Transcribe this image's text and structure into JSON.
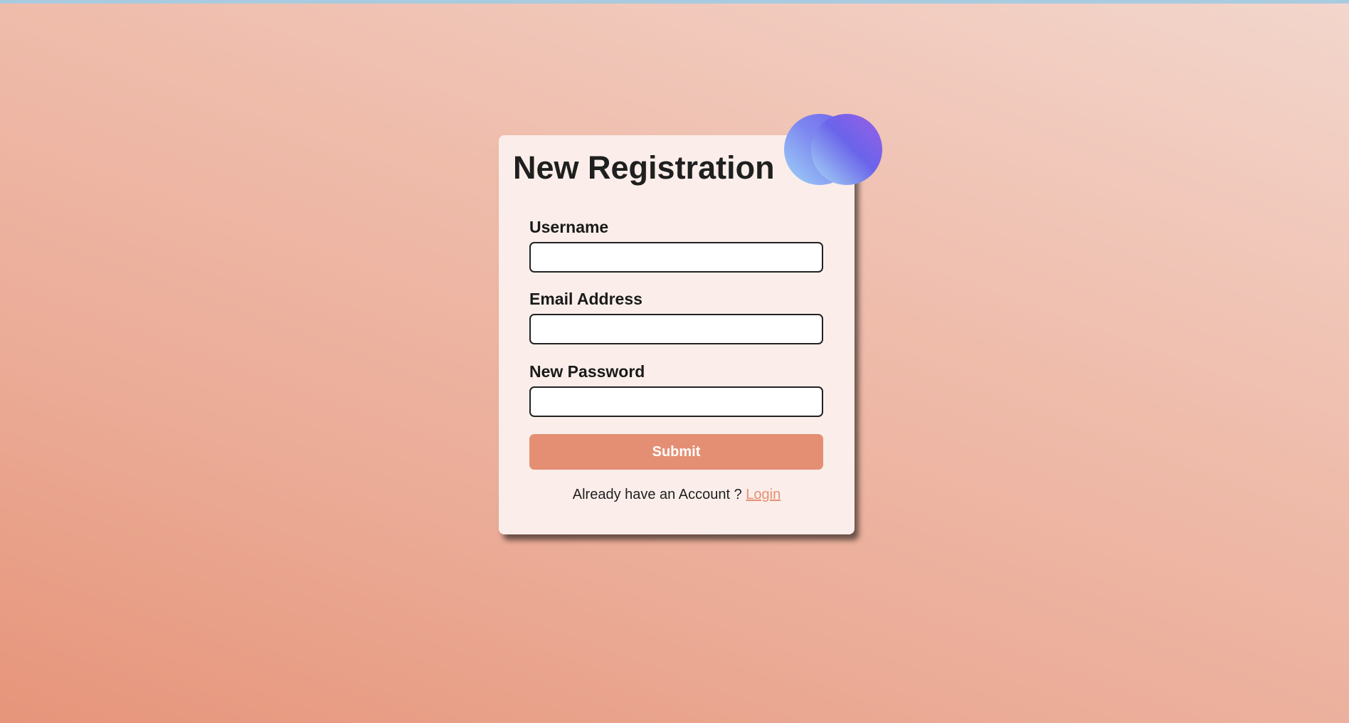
{
  "form": {
    "title": "New Registration",
    "fields": [
      {
        "label": "Username",
        "value": "",
        "placeholder": ""
      },
      {
        "label": "Email Address",
        "value": "",
        "placeholder": ""
      },
      {
        "label": "New Password",
        "value": "",
        "placeholder": ""
      }
    ],
    "submit_label": "Submit",
    "footer_text": "Already have an Account ?",
    "login_link": "Login"
  },
  "colors": {
    "accent": "#e48f73",
    "card_background": "#fbeeea",
    "decor_circle_start": "#6f62ea",
    "decor_circle_end": "#a8dcf6"
  }
}
